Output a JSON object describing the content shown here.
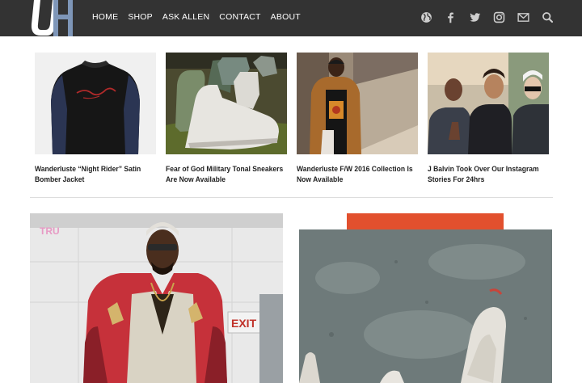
{
  "header": {
    "logo_text": "UH",
    "nav": [
      "HOME",
      "SHOP",
      "ASK ALLEN",
      "CONTACT",
      "ABOUT"
    ],
    "social_icons": [
      "globe-icon",
      "facebook-icon",
      "twitter-icon",
      "instagram-icon",
      "mail-icon",
      "search-icon"
    ],
    "colors": {
      "bar": "#333333",
      "logo_accent": "#7e96b8",
      "text": "#ffffff"
    }
  },
  "featured": [
    {
      "title": "Wanderluste “Night Rider” Satin Bomber Jacket"
    },
    {
      "title": "Fear of God Military Tonal Sneakers Are Now Available"
    },
    {
      "title": "Wanderluste F/W 2016 Collection Is Now Available"
    },
    {
      "title": "J Balvin Took Over Our Instagram Stories For 24hrs"
    }
  ],
  "posts": {
    "left_sign_text": "TRU",
    "left_exit_text": "EXIT"
  }
}
